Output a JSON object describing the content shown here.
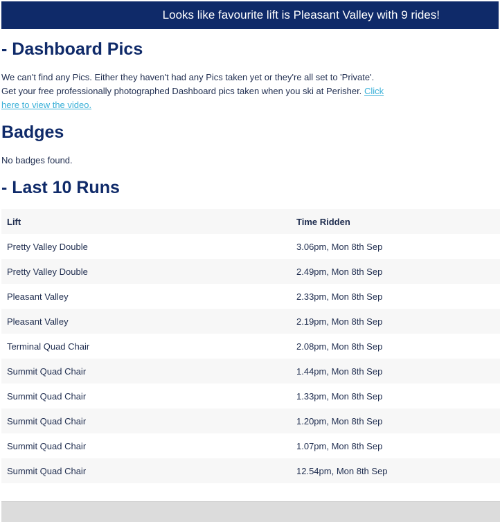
{
  "banner": {
    "text": "Looks like favourite lift is Pleasant Valley with 9 rides!"
  },
  "pics": {
    "heading": "- Dashboard Pics",
    "line1": "We can't find any Pics. Either they haven't had any Pics taken yet or they're all set to 'Private'.",
    "line2": "Get your free professionally photographed Dashboard pics taken when you ski at Perisher.",
    "link_text": "Click here to view the video."
  },
  "badges": {
    "heading": "Badges",
    "empty_text": "No badges found."
  },
  "runs": {
    "heading": "- Last 10 Runs",
    "columns": [
      "Lift",
      "Time Ridden"
    ],
    "rows": [
      [
        "Pretty Valley Double",
        "3.06pm, Mon 8th Sep"
      ],
      [
        "Pretty Valley Double",
        "2.49pm, Mon 8th Sep"
      ],
      [
        "Pleasant Valley",
        "2.33pm, Mon 8th Sep"
      ],
      [
        "Pleasant Valley",
        "2.19pm, Mon 8th Sep"
      ],
      [
        "Terminal Quad Chair",
        "2.08pm, Mon 8th Sep"
      ],
      [
        "Summit Quad Chair",
        "1.44pm, Mon 8th Sep"
      ],
      [
        "Summit Quad Chair",
        "1.33pm, Mon 8th Sep"
      ],
      [
        "Summit Quad Chair",
        "1.20pm, Mon 8th Sep"
      ],
      [
        "Summit Quad Chair",
        "1.07pm, Mon 8th Sep"
      ],
      [
        "Summit Quad Chair",
        "12.54pm, Mon 8th Sep"
      ]
    ]
  }
}
